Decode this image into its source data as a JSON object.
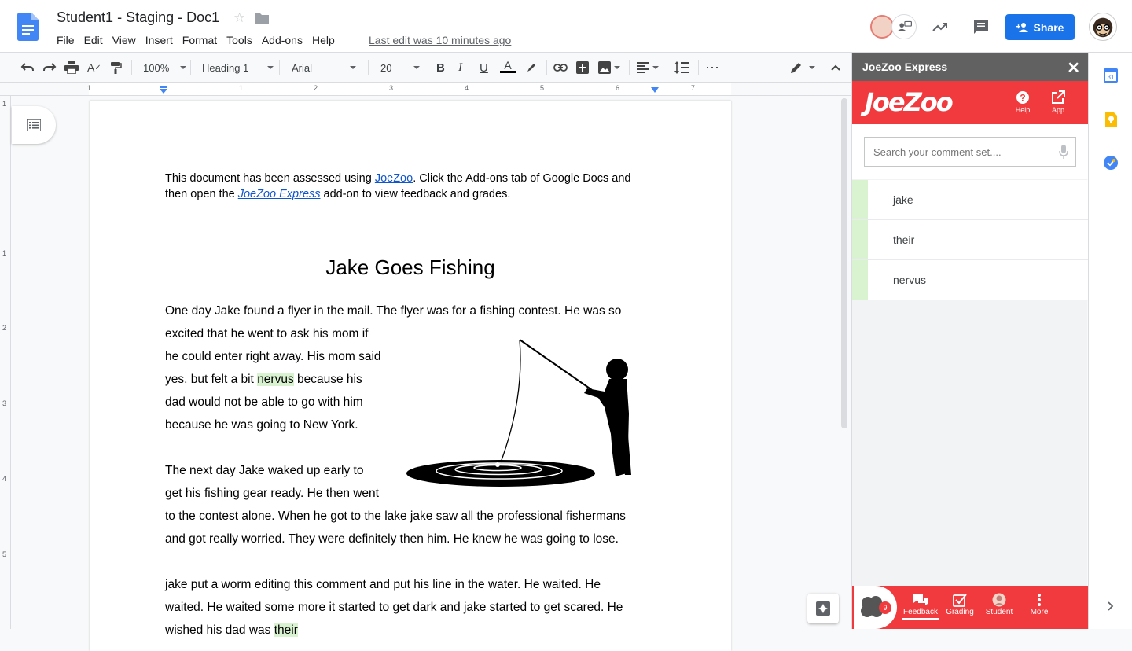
{
  "doc": {
    "title": "Student1 - Staging - Doc1",
    "last_edit": "Last edit was 10 minutes ago",
    "menu": [
      "File",
      "Edit",
      "View",
      "Insert",
      "Format",
      "Tools",
      "Add-ons",
      "Help"
    ]
  },
  "header": {
    "share_label": "Share"
  },
  "toolbar": {
    "zoom": "100%",
    "style": "Heading 1",
    "font": "Arial",
    "size": "20"
  },
  "ruler": {
    "marks": [
      "1",
      "1",
      "2",
      "3",
      "4",
      "5",
      "6",
      "7"
    ],
    "vmarks": [
      "1",
      "1",
      "2",
      "3",
      "4",
      "5"
    ]
  },
  "document": {
    "note_pre": "This document has been assessed using ",
    "note_link1": "JoeZoo",
    "note_mid": ". Click the Add-ons tab of Google Docs and then open the ",
    "note_link2": "JoeZoo Express",
    "note_post": " add-on to view feedback and grades.",
    "story_title": "Jake Goes Fishing",
    "p1_line1": "One day Jake found a flyer in the mail. The flyer was for a fishing contest. He was so",
    "p1_line2": "excited that he went to ask his mom if",
    "p1_line3": "he could enter right away. His mom said",
    "p1_line4_pre": "yes, but felt a bit ",
    "p1_line4_hl": "nervus",
    "p1_line4_post": " because his",
    "p1_line5": "dad would not be able to go with him",
    "p1_line6": "because he was going to New York.",
    "p2_line1": "The next day Jake waked up early to",
    "p2_line2": "get his fishing gear ready. He then went",
    "p2_line3": "to the contest alone. When he got to the lake jake saw all the professional fishermans",
    "p2_line4": "and got really worried.  They were definitely then him.  He knew he was going to lose.",
    "p3_line1": "jake put a worm editing this comment and put his line in the water. He waited. He",
    "p3_line2": "waited. He waited some more it started to get dark and jake started to get scared. He",
    "p3_line3_pre": "wished his dad was ",
    "p3_line3_hl": "their"
  },
  "panel": {
    "title": "JoeZoo Express",
    "logo": "JoeZoo",
    "help": "Help",
    "app": "App",
    "search_placeholder": "Search your comment set....",
    "comments": [
      "jake",
      "their",
      "nervus"
    ],
    "badge": "9",
    "footer": [
      "Feedback",
      "Grading",
      "Student",
      "More"
    ]
  },
  "colors": {
    "brand_red": "#f03a3e",
    "share_blue": "#1a73e8",
    "highlight_green": "#d9f2d0"
  }
}
